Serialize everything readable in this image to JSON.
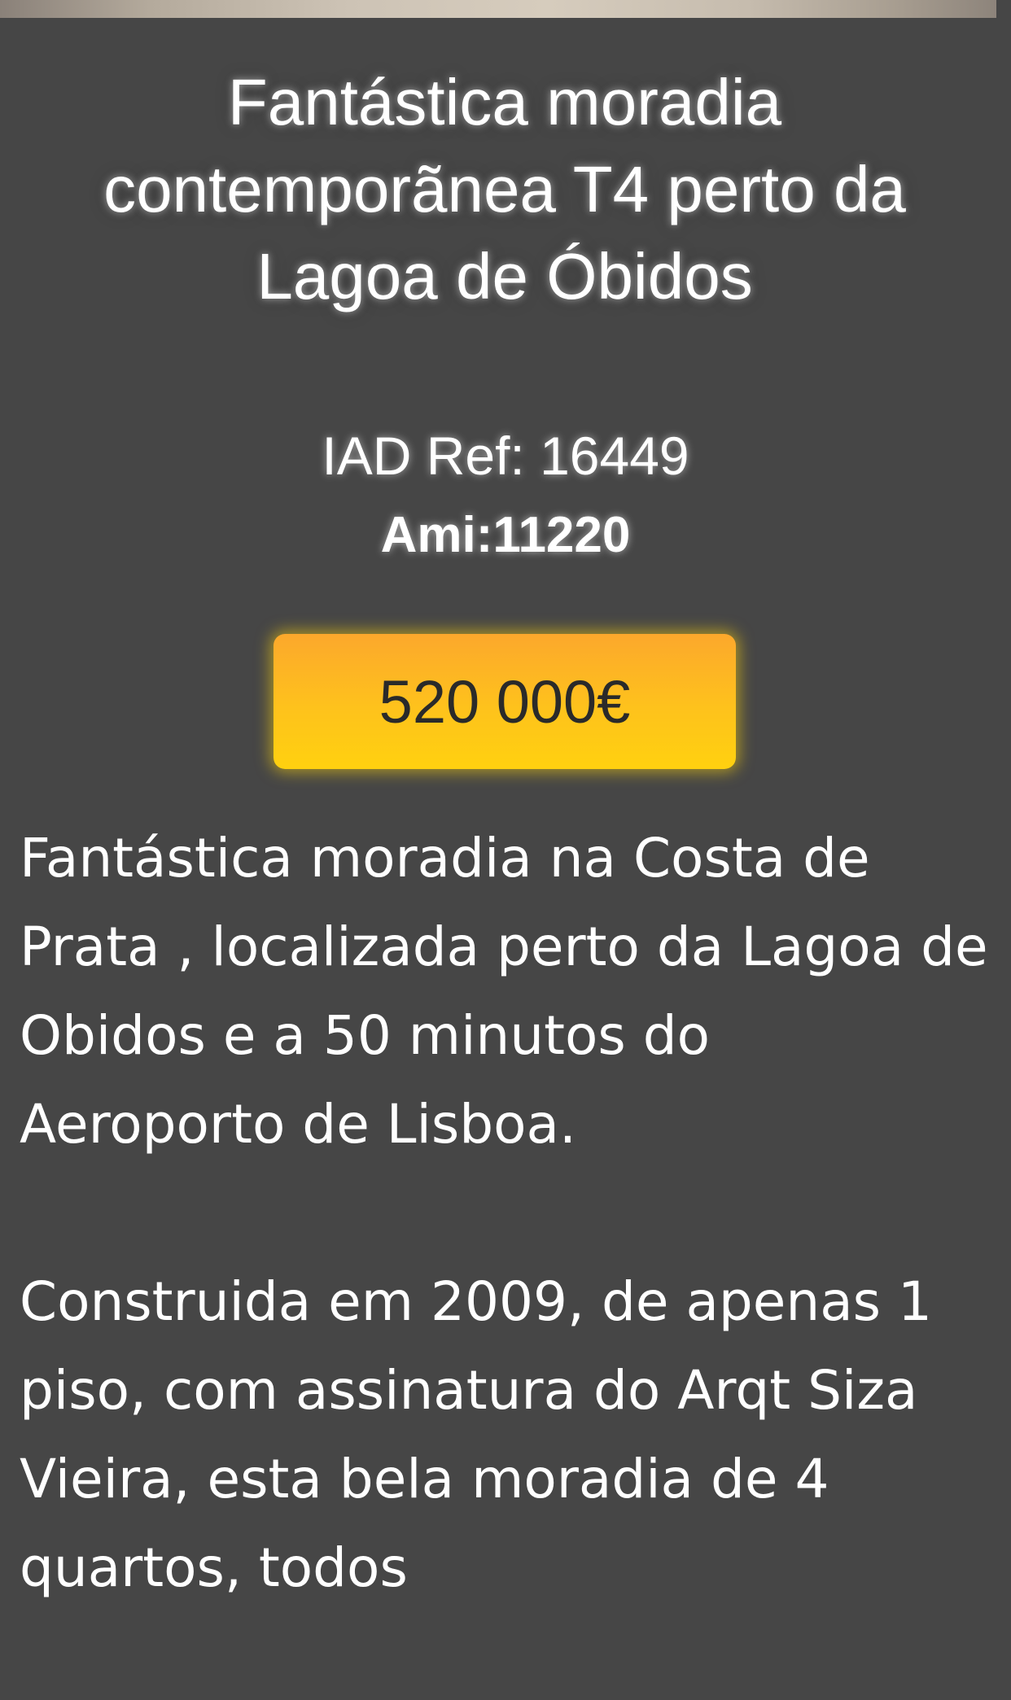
{
  "listing": {
    "title": "Fantástica moradia contemporãnea T4 perto da Lagoa de Óbidos",
    "reference": "IAD Ref: 16449",
    "ami": "Ami:11220",
    "price": "520 000€",
    "description": [
      "Fantástica moradia na Costa de Prata , localizada perto da Lagoa de Obidos e a 50 minutos do Aeroporto de Lisboa.",
      "Construida em 2009, de apenas 1 piso, com assinatura do Arqt Siza Vieira, esta bela moradia de 4 quartos, todos"
    ]
  },
  "colors": {
    "background": "#464646",
    "price_button_top": "#fca82c",
    "price_button_bottom": "#ffd10f",
    "text": "#ffffff",
    "price_text": "#2a2a2a"
  }
}
